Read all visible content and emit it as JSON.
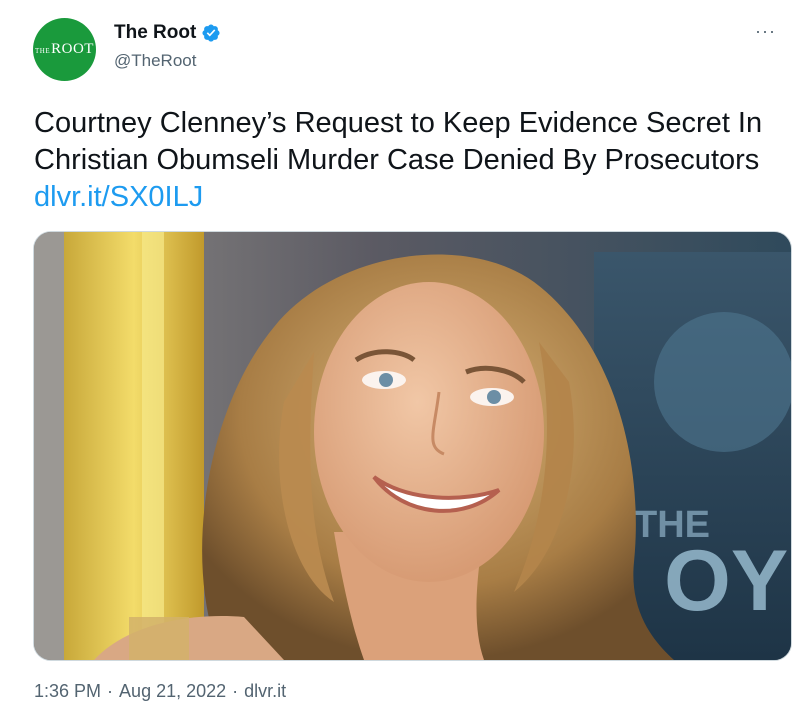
{
  "author": {
    "display_name": "The Root",
    "handle": "@TheRoot",
    "avatar_text_small": "THE",
    "avatar_text": "ROOT",
    "verified": true,
    "avatar_color": "#1a9a3c"
  },
  "menu": {
    "more_label": "···"
  },
  "tweet": {
    "text": "Courtney Clenney’s Request to Keep Evidence Secret In Christian Obumseli Murder Case Denied By Prosecutors ",
    "link_text": "dlvr.it/SX0ILJ",
    "link_color": "#1d9bf0"
  },
  "media": {
    "alt_description": "photo-of-smiling-woman",
    "poster_text_1": "THE",
    "poster_text_2": "OY"
  },
  "meta": {
    "time": "1:36 PM",
    "date": "Aug 21, 2022",
    "source": "dlvr.it",
    "separator": "·"
  }
}
